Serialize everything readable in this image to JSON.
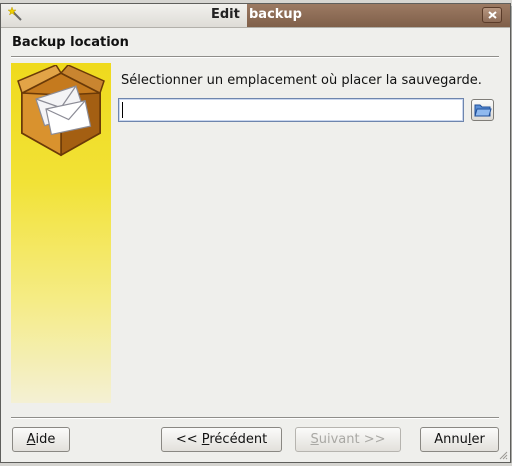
{
  "window": {
    "title_prefix": "Edit",
    "title_highlight": "backup",
    "icon": "wand-icon",
    "close_icon": "close-icon"
  },
  "page": {
    "title": "Backup location",
    "instruction": "Sélectionner un emplacement où placer la sauvegarde.",
    "banner_icon": "box-envelope-icon"
  },
  "location_field": {
    "value": "",
    "placeholder": "",
    "browse_icon": "folder-open-icon"
  },
  "buttons": {
    "help": {
      "pre": "",
      "key": "A",
      "post": "ide"
    },
    "previous": {
      "pre": "<< ",
      "key": "P",
      "post": "récédent"
    },
    "next": {
      "pre": "",
      "key": "S",
      "post": "uivant >>",
      "enabled": false
    },
    "cancel": {
      "pre": "Annu",
      "key": "l",
      "post": "er"
    }
  },
  "colors": {
    "banner_top": "#efda1d",
    "banner_bottom": "#f4f0d4",
    "title_highlight_bg": "#8b6b55",
    "input_border": "#6e85ad"
  }
}
